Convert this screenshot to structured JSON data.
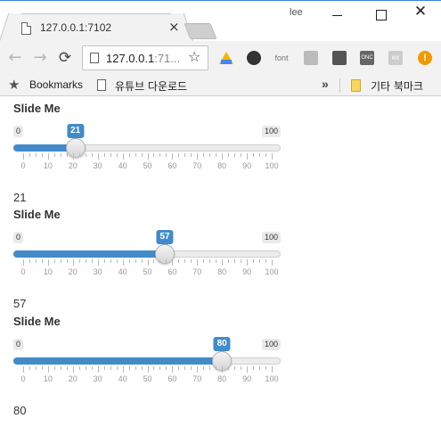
{
  "window": {
    "tab_title": "127.0.0.1:7102",
    "tab_close": "×",
    "user_label": "lee",
    "close_glyph": "✕"
  },
  "toolbar": {
    "back_glyph": "←",
    "forward_glyph": "→",
    "reload_glyph": "⟳",
    "url_main": "127.0.0.1",
    "url_port": ":71...",
    "star_glyph": "☆",
    "extensions": [
      "google-drive-icon",
      "mask-icon",
      "font-icon",
      "camera-icon",
      "dark-reader-icon",
      "onc-icon",
      "ex-icon",
      "warning-icon"
    ],
    "ext_font_label": "font",
    "ext_onc_label": "ONC",
    "ext_ex_label": "ex",
    "ext_warn_label": "!"
  },
  "bookmarks": {
    "star_glyph": "★",
    "label": "Bookmarks",
    "youtube": "유튜브 다운로드",
    "more_glyph": "»",
    "other": "기타 북마크"
  },
  "sliders": [
    {
      "title": "Slide Me",
      "min": 0,
      "max": 100,
      "value": 21,
      "output": "21"
    },
    {
      "title": "Slide Me",
      "min": 0,
      "max": 100,
      "value": 57,
      "output": "57"
    },
    {
      "title": "Slide Me",
      "min": 0,
      "max": 100,
      "value": 80,
      "output": "80"
    }
  ],
  "tick_labels": [
    "0",
    "10",
    "20",
    "30",
    "40",
    "50",
    "60",
    "70",
    "80",
    "90",
    "100"
  ],
  "colors": {
    "accent": "#428bca",
    "chrome_bg": "#f2f2f2",
    "track": "#ececec",
    "warning": "#f29900"
  }
}
